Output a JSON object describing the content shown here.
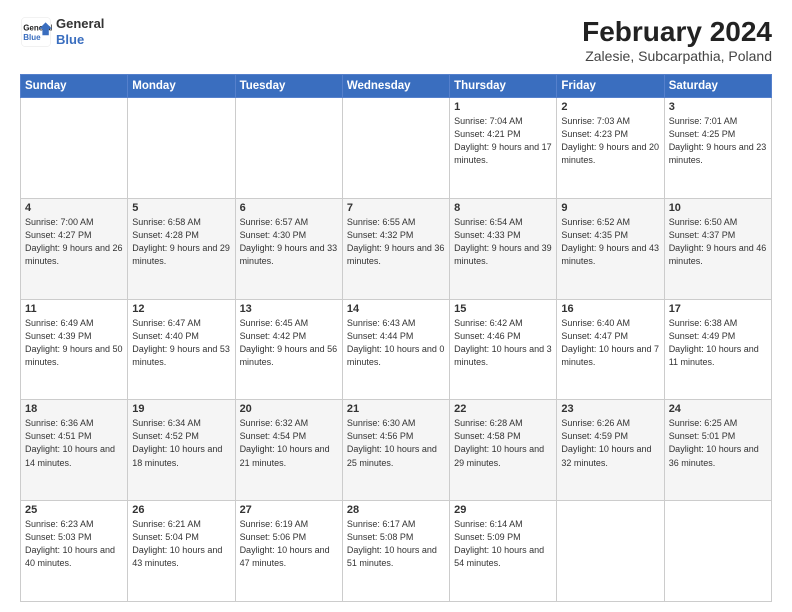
{
  "logo": {
    "line1": "General",
    "line2": "Blue"
  },
  "title": "February 2024",
  "subtitle": "Zalesie, Subcarpathia, Poland",
  "days_header": [
    "Sunday",
    "Monday",
    "Tuesday",
    "Wednesday",
    "Thursday",
    "Friday",
    "Saturday"
  ],
  "weeks": [
    [
      {
        "day": "",
        "info": ""
      },
      {
        "day": "",
        "info": ""
      },
      {
        "day": "",
        "info": ""
      },
      {
        "day": "",
        "info": ""
      },
      {
        "day": "1",
        "info": "Sunrise: 7:04 AM\nSunset: 4:21 PM\nDaylight: 9 hours\nand 17 minutes."
      },
      {
        "day": "2",
        "info": "Sunrise: 7:03 AM\nSunset: 4:23 PM\nDaylight: 9 hours\nand 20 minutes."
      },
      {
        "day": "3",
        "info": "Sunrise: 7:01 AM\nSunset: 4:25 PM\nDaylight: 9 hours\nand 23 minutes."
      }
    ],
    [
      {
        "day": "4",
        "info": "Sunrise: 7:00 AM\nSunset: 4:27 PM\nDaylight: 9 hours\nand 26 minutes."
      },
      {
        "day": "5",
        "info": "Sunrise: 6:58 AM\nSunset: 4:28 PM\nDaylight: 9 hours\nand 29 minutes."
      },
      {
        "day": "6",
        "info": "Sunrise: 6:57 AM\nSunset: 4:30 PM\nDaylight: 9 hours\nand 33 minutes."
      },
      {
        "day": "7",
        "info": "Sunrise: 6:55 AM\nSunset: 4:32 PM\nDaylight: 9 hours\nand 36 minutes."
      },
      {
        "day": "8",
        "info": "Sunrise: 6:54 AM\nSunset: 4:33 PM\nDaylight: 9 hours\nand 39 minutes."
      },
      {
        "day": "9",
        "info": "Sunrise: 6:52 AM\nSunset: 4:35 PM\nDaylight: 9 hours\nand 43 minutes."
      },
      {
        "day": "10",
        "info": "Sunrise: 6:50 AM\nSunset: 4:37 PM\nDaylight: 9 hours\nand 46 minutes."
      }
    ],
    [
      {
        "day": "11",
        "info": "Sunrise: 6:49 AM\nSunset: 4:39 PM\nDaylight: 9 hours\nand 50 minutes."
      },
      {
        "day": "12",
        "info": "Sunrise: 6:47 AM\nSunset: 4:40 PM\nDaylight: 9 hours\nand 53 minutes."
      },
      {
        "day": "13",
        "info": "Sunrise: 6:45 AM\nSunset: 4:42 PM\nDaylight: 9 hours\nand 56 minutes."
      },
      {
        "day": "14",
        "info": "Sunrise: 6:43 AM\nSunset: 4:44 PM\nDaylight: 10 hours\nand 0 minutes."
      },
      {
        "day": "15",
        "info": "Sunrise: 6:42 AM\nSunset: 4:46 PM\nDaylight: 10 hours\nand 3 minutes."
      },
      {
        "day": "16",
        "info": "Sunrise: 6:40 AM\nSunset: 4:47 PM\nDaylight: 10 hours\nand 7 minutes."
      },
      {
        "day": "17",
        "info": "Sunrise: 6:38 AM\nSunset: 4:49 PM\nDaylight: 10 hours\nand 11 minutes."
      }
    ],
    [
      {
        "day": "18",
        "info": "Sunrise: 6:36 AM\nSunset: 4:51 PM\nDaylight: 10 hours\nand 14 minutes."
      },
      {
        "day": "19",
        "info": "Sunrise: 6:34 AM\nSunset: 4:52 PM\nDaylight: 10 hours\nand 18 minutes."
      },
      {
        "day": "20",
        "info": "Sunrise: 6:32 AM\nSunset: 4:54 PM\nDaylight: 10 hours\nand 21 minutes."
      },
      {
        "day": "21",
        "info": "Sunrise: 6:30 AM\nSunset: 4:56 PM\nDaylight: 10 hours\nand 25 minutes."
      },
      {
        "day": "22",
        "info": "Sunrise: 6:28 AM\nSunset: 4:58 PM\nDaylight: 10 hours\nand 29 minutes."
      },
      {
        "day": "23",
        "info": "Sunrise: 6:26 AM\nSunset: 4:59 PM\nDaylight: 10 hours\nand 32 minutes."
      },
      {
        "day": "24",
        "info": "Sunrise: 6:25 AM\nSunset: 5:01 PM\nDaylight: 10 hours\nand 36 minutes."
      }
    ],
    [
      {
        "day": "25",
        "info": "Sunrise: 6:23 AM\nSunset: 5:03 PM\nDaylight: 10 hours\nand 40 minutes."
      },
      {
        "day": "26",
        "info": "Sunrise: 6:21 AM\nSunset: 5:04 PM\nDaylight: 10 hours\nand 43 minutes."
      },
      {
        "day": "27",
        "info": "Sunrise: 6:19 AM\nSunset: 5:06 PM\nDaylight: 10 hours\nand 47 minutes."
      },
      {
        "day": "28",
        "info": "Sunrise: 6:17 AM\nSunset: 5:08 PM\nDaylight: 10 hours\nand 51 minutes."
      },
      {
        "day": "29",
        "info": "Sunrise: 6:14 AM\nSunset: 5:09 PM\nDaylight: 10 hours\nand 54 minutes."
      },
      {
        "day": "",
        "info": ""
      },
      {
        "day": "",
        "info": ""
      }
    ]
  ]
}
